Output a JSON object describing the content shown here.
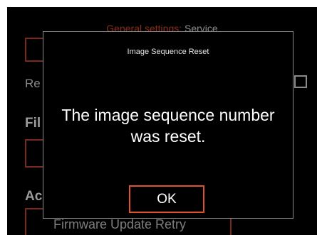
{
  "background": {
    "title_path": "General settings: ",
    "title_current": "Service",
    "row_label_partial": "Re",
    "section_heading_1": "Fil",
    "section_heading_2": "Ac",
    "list_item_text": "Firmware Update Retry"
  },
  "dialog": {
    "title": "Image Sequence Reset",
    "message": "The image sequence number was reset.",
    "ok_label": "OK"
  },
  "colors": {
    "accent": "#e0502b",
    "background": "#000000",
    "text": "#ffffff"
  }
}
